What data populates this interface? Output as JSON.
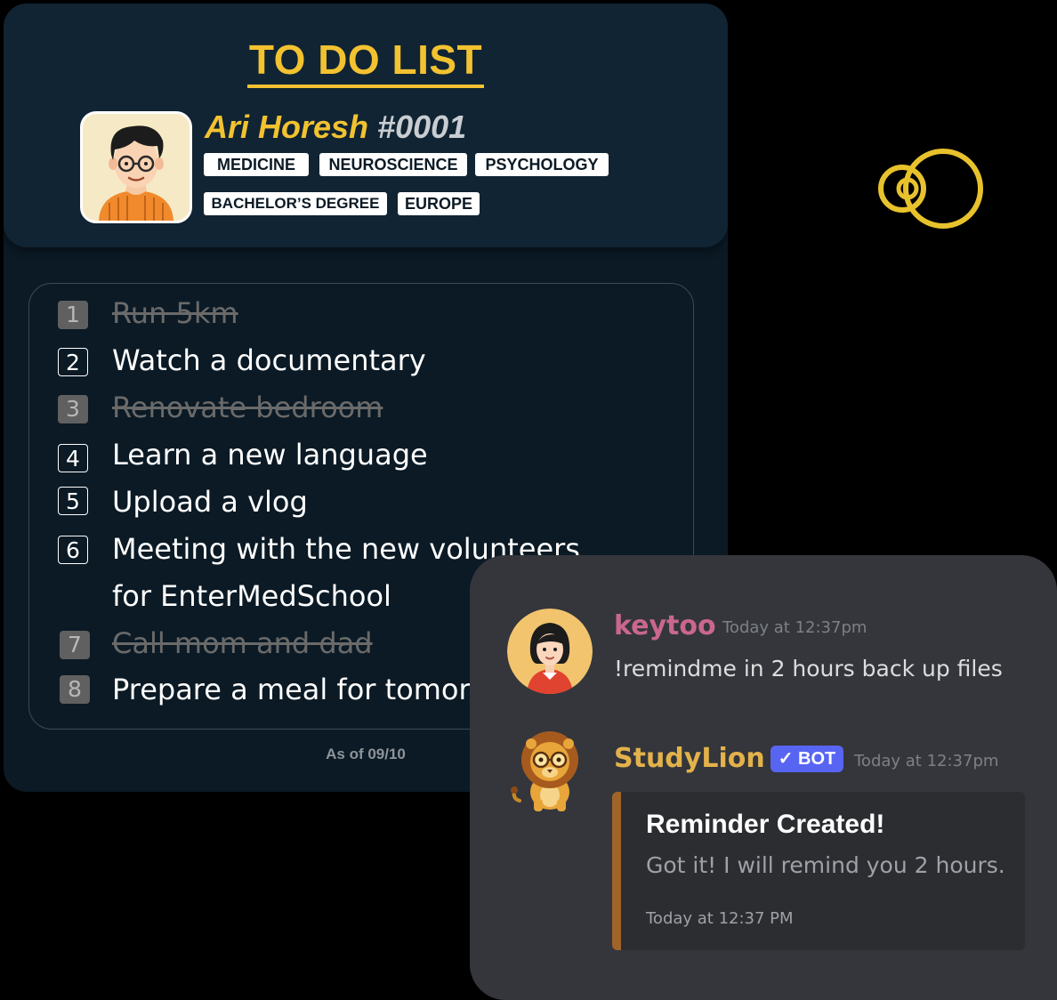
{
  "todo": {
    "title": "TO DO LIST",
    "user": {
      "name": "Ari Horesh",
      "tag": "#0001",
      "avatar_icon": "man-with-glasses-avatar-icon",
      "tags": [
        "MEDICINE",
        "NEUROSCIENCE",
        "PSYCHOLOGY",
        "BACHELOR’S DEGREE",
        "EUROPE"
      ]
    },
    "items": [
      {
        "num": "1",
        "text": "Run 5km",
        "done": true
      },
      {
        "num": "2",
        "text": "Watch a documentary",
        "done": false
      },
      {
        "num": "3",
        "text": "Renovate bedroom",
        "done": true
      },
      {
        "num": "4",
        "text": "Learn a new language",
        "done": false
      },
      {
        "num": "5",
        "text": "Upload a vlog",
        "done": false
      },
      {
        "num": "6",
        "text": "Meeting with the new volunteers",
        "text2": "for EnterMedSchool",
        "done": false
      },
      {
        "num": "7",
        "text": "Call mom and dad",
        "done": true
      },
      {
        "num": "8",
        "text": "Prepare a meal for tomorrow",
        "done": false
      }
    ],
    "as_of": "As of 09/10"
  },
  "decoration": {
    "icon": "yellow-rings-icon"
  },
  "chat": {
    "messages": [
      {
        "author": "keytoo",
        "timestamp": "Today at 12:37pm",
        "text": "!remindme in 2 hours back up files",
        "avatar_icon": "woman-avatar-icon"
      },
      {
        "author": "StudyLion",
        "badge": "BOT",
        "timestamp": "Today at 12:37pm",
        "avatar_icon": "lion-with-glasses-avatar-icon",
        "embed": {
          "title": "Reminder Created!",
          "description": "Got it! I will remind you 2 hours.",
          "footer": "Today at 12:37 PM"
        }
      }
    ]
  },
  "colors": {
    "accent_yellow": "#f2c230",
    "card_bg": "#0b1a25",
    "header_bg": "#102433",
    "chat_bg": "#34363b",
    "keytoo_name": "#c9678f",
    "studylion_name": "#e3b24a",
    "bot_badge": "#5865f2",
    "embed_bar": "#a0642a"
  }
}
